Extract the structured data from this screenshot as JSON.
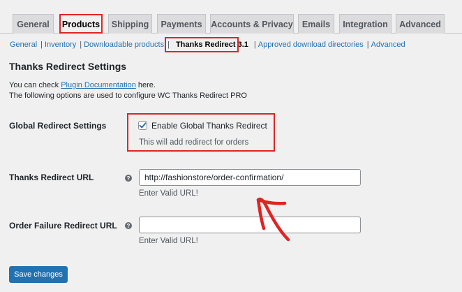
{
  "tabs": [
    {
      "label": "General",
      "active": false
    },
    {
      "label": "Products",
      "active": true
    },
    {
      "label": "Shipping",
      "active": false
    },
    {
      "label": "Payments",
      "active": false
    },
    {
      "label": "Accounts & Privacy",
      "active": false
    },
    {
      "label": "Emails",
      "active": false
    },
    {
      "label": "Integration",
      "active": false
    },
    {
      "label": "Advanced",
      "active": false
    }
  ],
  "subnav": {
    "items": [
      "General",
      "Inventory",
      "Downloadable products",
      "Thanks Redirect 3.1",
      "Approved download directories",
      "Advanced"
    ],
    "separator": "|"
  },
  "settings": {
    "title": "Thanks Redirect Settings",
    "intro_prefix": "You can check ",
    "intro_link": "Plugin Documentation",
    "intro_suffix": " here.",
    "intro_line2": "The following options are used to configure WC Thanks Redirect PRO"
  },
  "global_redirect": {
    "label": "Global Redirect Settings",
    "checkbox_label": "Enable Global Thanks Redirect",
    "checked": true,
    "note": "This will add redirect for orders"
  },
  "thanks_url": {
    "label": "Thanks Redirect URL",
    "help": "?",
    "value": "http://fashionstore/order-confirmation/",
    "note": "Enter Valid URL!"
  },
  "failure_url": {
    "label": "Order Failure Redirect URL",
    "help": "?",
    "value": "",
    "note": "Enter Valid URL!"
  },
  "actions": {
    "save_label": "Save changes"
  },
  "colors": {
    "accent": "#2271b1",
    "highlight": "#e02424"
  }
}
